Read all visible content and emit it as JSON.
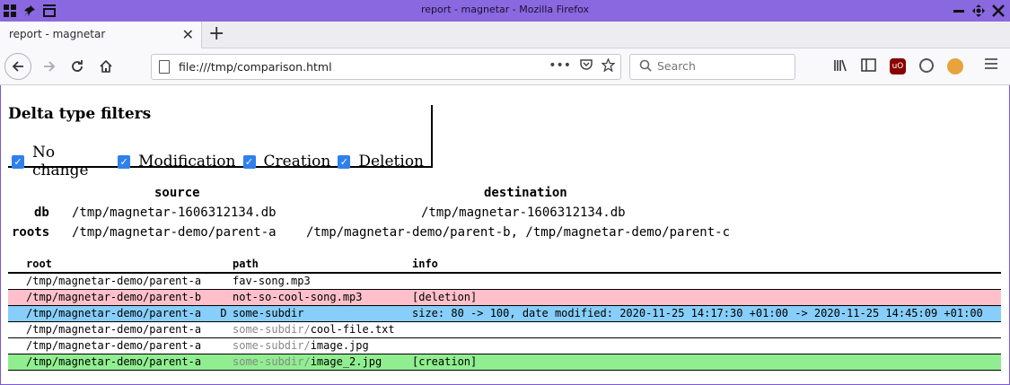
{
  "window": {
    "title": "report - magnetar - Mozilla Firefox",
    "frame_color": "#8a68e0"
  },
  "browser": {
    "tab_title": "report - magnetar",
    "url": "file:///tmp/comparison.html",
    "search_placeholder": "Search",
    "icons": [
      "back-icon",
      "forward-icon",
      "reload-icon",
      "home-icon",
      "page-icon",
      "more-icon",
      "pocket-icon",
      "star-icon",
      "search-icon",
      "library-icon",
      "sidebar-icon",
      "ublock-icon",
      "account-icon",
      "extension-icon",
      "menu-icon"
    ]
  },
  "filters": {
    "heading": "Delta type filters",
    "items": [
      {
        "label": "No change",
        "checked": true
      },
      {
        "label": "Modification",
        "checked": true
      },
      {
        "label": "Creation",
        "checked": true
      },
      {
        "label": "Deletion",
        "checked": true
      }
    ],
    "checkbox_color": "#2f80ed"
  },
  "summary": {
    "source_header": "source",
    "destination_header": "destination",
    "db_label": "db",
    "roots_label": "roots",
    "source_db": "/tmp/magnetar-1606312134.db",
    "destination_db": "/tmp/magnetar-1606312134.db",
    "source_roots": "/tmp/magnetar-demo/parent-a",
    "destination_roots": "/tmp/magnetar-demo/parent-b, /tmp/magnetar-demo/parent-c"
  },
  "table": {
    "headers": {
      "root": "root",
      "path": "path",
      "info": "info"
    },
    "rows": [
      {
        "type": "none",
        "root": "/tmp/magnetar-demo/parent-a",
        "mark": "",
        "path_prefix": "",
        "path_name": "fav-song.mp3",
        "info": ""
      },
      {
        "type": "deletion",
        "root": "/tmp/magnetar-demo/parent-b",
        "mark": "",
        "path_prefix": "",
        "path_name": "not-so-cool-song.mp3",
        "info": "[deletion]"
      },
      {
        "type": "modification",
        "root": "/tmp/magnetar-demo/parent-a",
        "mark": "D",
        "path_prefix": "",
        "path_name": "some-subdir",
        "info": "size: 80 -> 100, date modified: 2020-11-25 14:17:30 +01:00 -> 2020-11-25 14:45:09 +01:00"
      },
      {
        "type": "none",
        "root": "/tmp/magnetar-demo/parent-a",
        "mark": "",
        "path_prefix": "some-subdir/",
        "path_name": "cool-file.txt",
        "info": ""
      },
      {
        "type": "none",
        "root": "/tmp/magnetar-demo/parent-a",
        "mark": "",
        "path_prefix": "some-subdir/",
        "path_name": "image.jpg",
        "info": ""
      },
      {
        "type": "creation",
        "root": "/tmp/magnetar-demo/parent-a",
        "mark": "",
        "path_prefix": "some-subdir/",
        "path_name": "image_2.jpg",
        "info": "[creation]"
      }
    ],
    "colors": {
      "deletion": "#ffc0cb",
      "modification": "#87cefa",
      "creation": "#90ee90"
    }
  }
}
